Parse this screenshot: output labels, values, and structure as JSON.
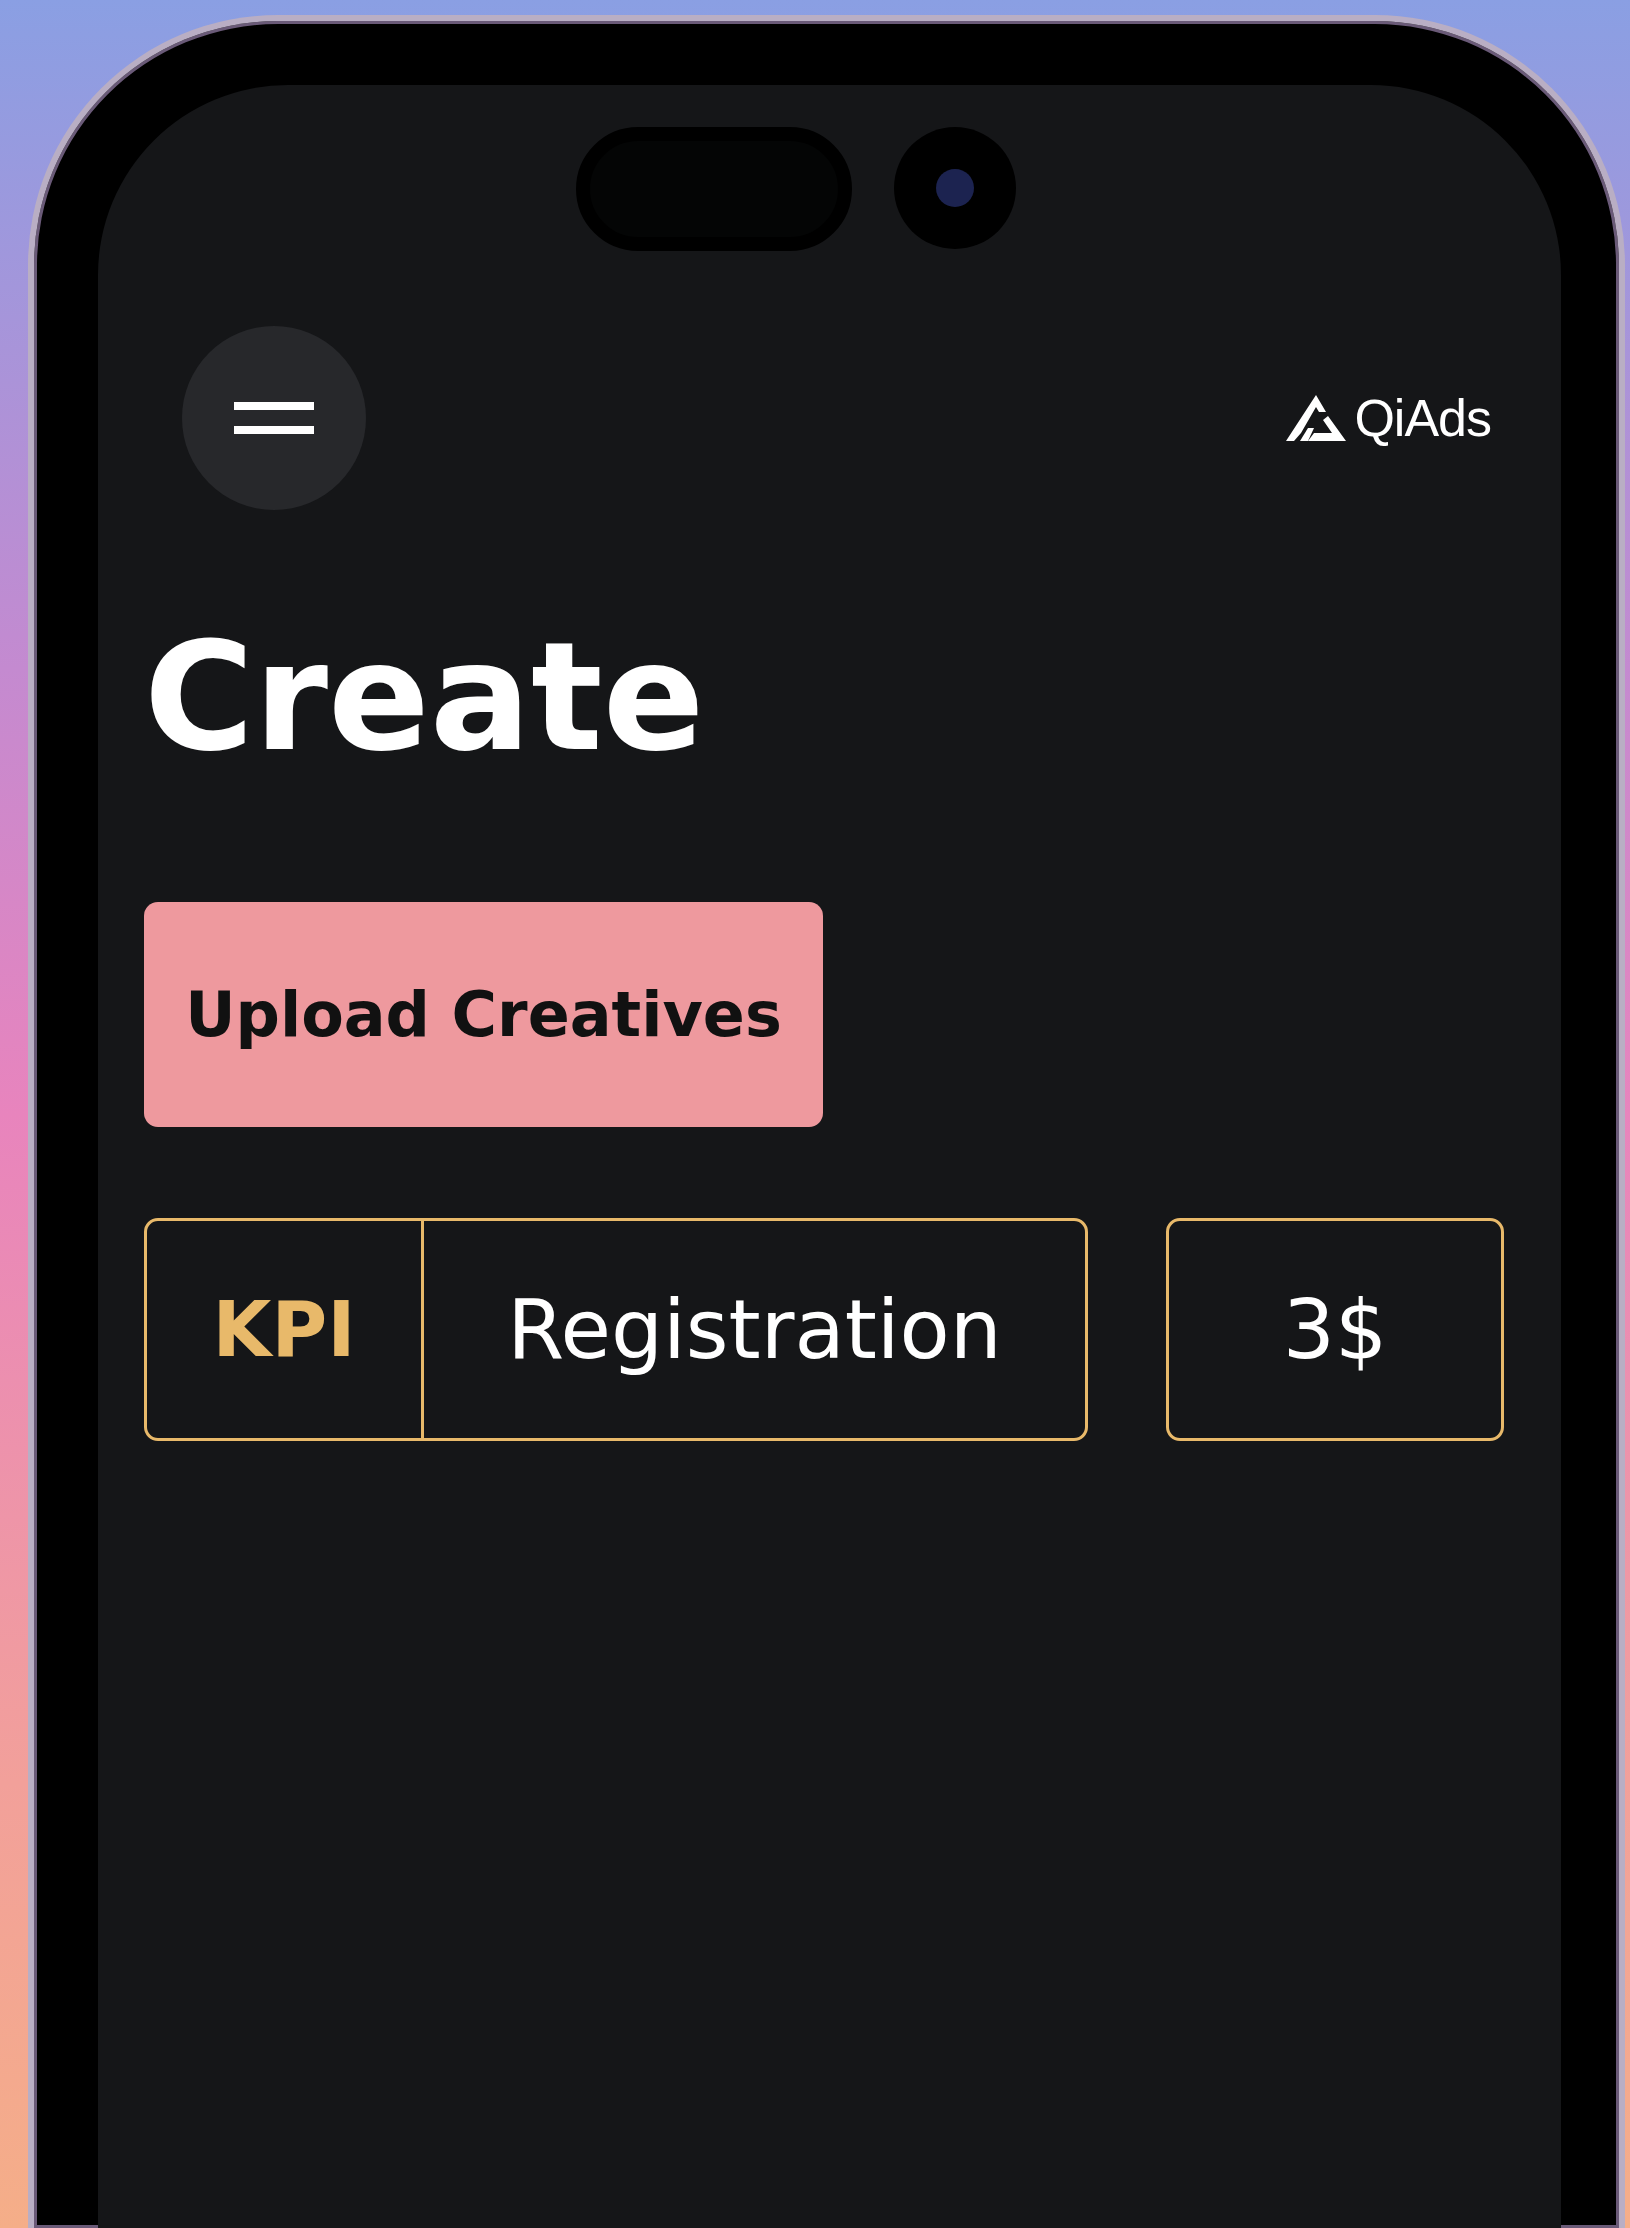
{
  "header": {
    "logo_text": "**Qi**Ads"
  },
  "title": "Create",
  "upload_button": "Upload Creatives",
  "kpi": {
    "label": "KPI",
    "value": "Registration"
  },
  "price": "3$"
}
